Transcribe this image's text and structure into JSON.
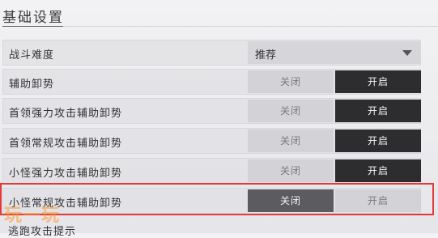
{
  "section": {
    "title": "基础设置"
  },
  "rows": [
    {
      "label": "战斗难度",
      "kind": "dropdown",
      "value": "推荐"
    },
    {
      "label": "辅助卸势",
      "off": "关闭",
      "on": "开启",
      "selected": "on"
    },
    {
      "label": "首领强力攻击辅助卸势",
      "off": "关闭",
      "on": "开启",
      "selected": "on"
    },
    {
      "label": "首领常规攻击辅助卸势",
      "off": "关闭",
      "on": "开启",
      "selected": "on"
    },
    {
      "label": "小怪强力攻击辅助卸势",
      "off": "关闭",
      "on": "开启",
      "selected": "on"
    },
    {
      "label": "小怪常规攻击辅助卸势",
      "off": "关闭",
      "on": "开启",
      "selected": "off"
    }
  ],
  "partial_row": {
    "label": "逃跑攻击提示"
  },
  "watermark": {
    "text": "玩一玩"
  },
  "colors": {
    "active_toggle": "#2d2d2f",
    "highlight_border": "#e23a3a"
  }
}
